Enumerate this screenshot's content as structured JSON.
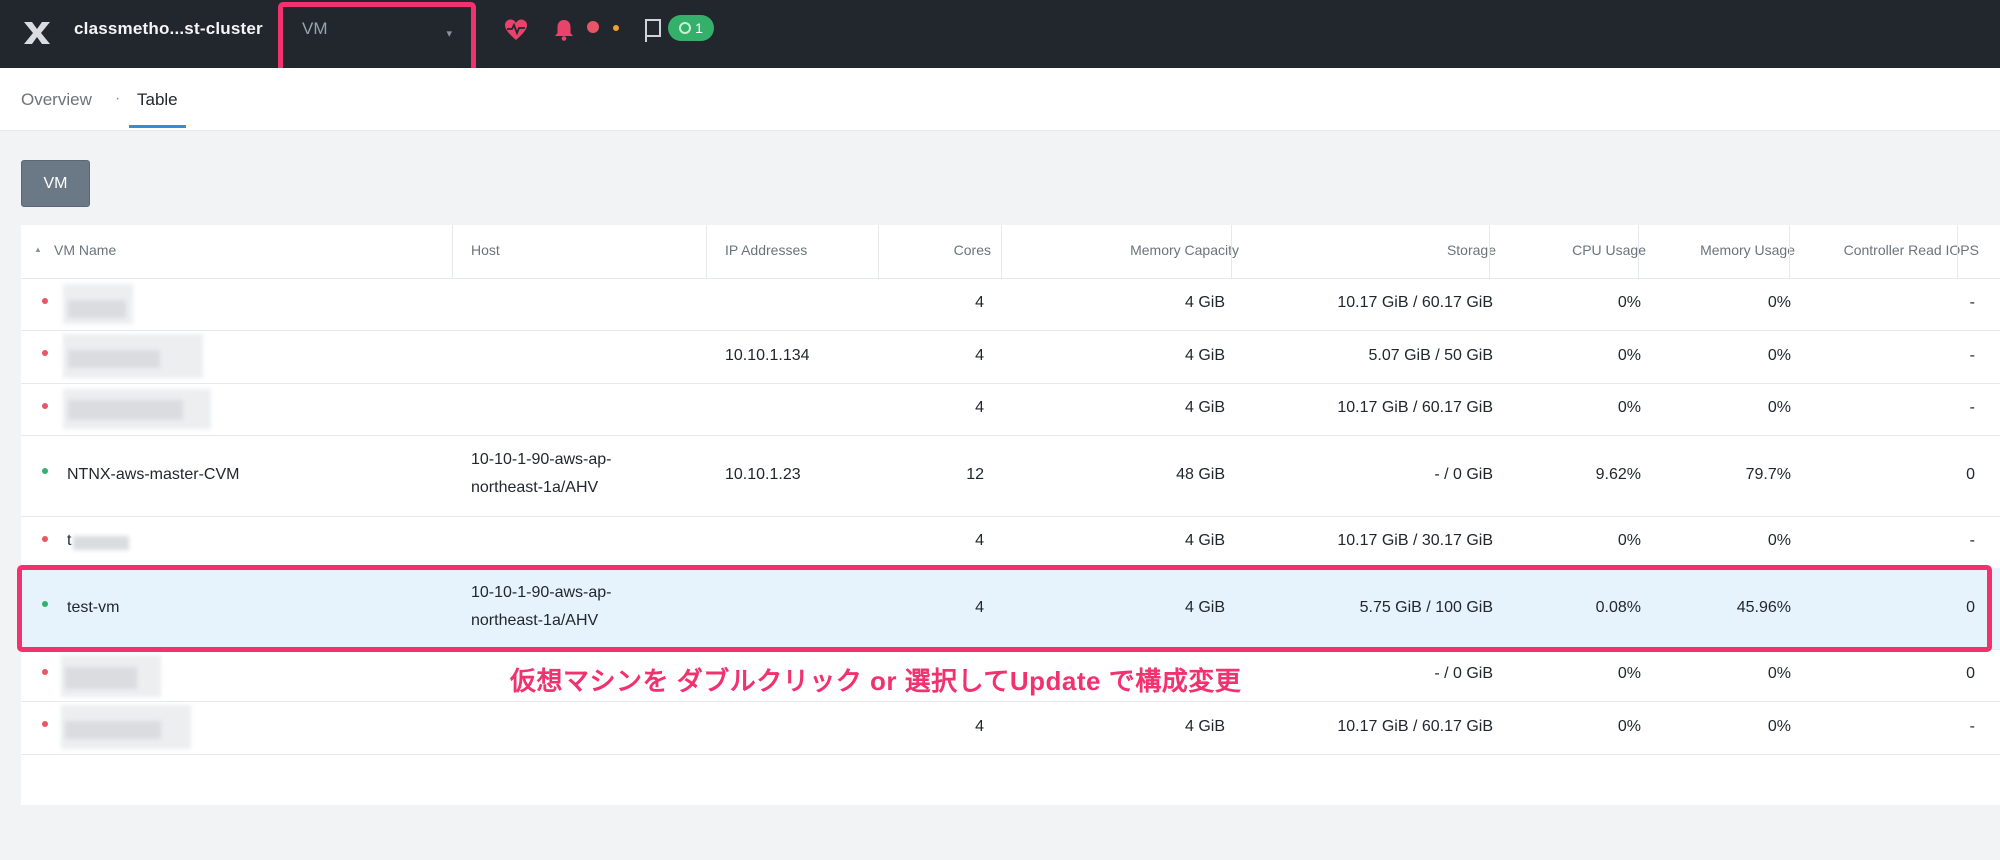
{
  "header": {
    "cluster_name": "classmetho...st-cluster",
    "entity_selector": "VM",
    "task_count": "1",
    "icons": [
      "x-logo-icon",
      "health-heart-icon",
      "alert-bell-icon",
      "task-flag-icon"
    ]
  },
  "tabs": {
    "overview": "Overview",
    "separator": "·",
    "table": "Table"
  },
  "vm_button": "VM",
  "table": {
    "columns": [
      "VM Name",
      "Host",
      "IP Addresses",
      "Cores",
      "Memory Capacity",
      "Storage",
      "CPU Usage",
      "Memory Usage",
      "Controller Read IOPS"
    ],
    "rows": [
      {
        "status": "off",
        "name": "",
        "host": "",
        "host2": "",
        "ip": "",
        "cores": "4",
        "memory": "4 GiB",
        "storage": "10.17 GiB / 60.17 GiB",
        "cpu": "0%",
        "mem_usage": "0%",
        "iops": "-"
      },
      {
        "status": "off",
        "name": "",
        "host": "",
        "host2": "",
        "ip": "10.10.1.134",
        "cores": "4",
        "memory": "4 GiB",
        "storage": "5.07 GiB / 50 GiB",
        "cpu": "0%",
        "mem_usage": "0%",
        "iops": "-"
      },
      {
        "status": "off",
        "name": "",
        "host": "",
        "host2": "",
        "ip": "",
        "cores": "4",
        "memory": "4 GiB",
        "storage": "10.17 GiB / 60.17 GiB",
        "cpu": "0%",
        "mem_usage": "0%",
        "iops": "-"
      },
      {
        "status": "on",
        "name": "NTNX-aws-master-CVM",
        "host": "10-10-1-90-aws-ap-",
        "host2": "northeast-1a/AHV",
        "ip": "10.10.1.23",
        "cores": "12",
        "memory": "48 GiB",
        "storage": "- / 0 GiB",
        "cpu": "9.62%",
        "mem_usage": "79.7%",
        "iops": "0"
      },
      {
        "status": "off",
        "name": "t",
        "host": "",
        "host2": "",
        "ip": "",
        "cores": "4",
        "memory": "4 GiB",
        "storage": "10.17 GiB / 30.17 GiB",
        "cpu": "0%",
        "mem_usage": "0%",
        "iops": "-"
      },
      {
        "status": "on",
        "name": "test-vm",
        "host": "10-10-1-90-aws-ap-",
        "host2": "northeast-1a/AHV",
        "ip": "",
        "cores": "4",
        "memory": "4 GiB",
        "storage": "5.75 GiB / 100 GiB",
        "cpu": "0.08%",
        "mem_usage": "45.96%",
        "iops": "0"
      },
      {
        "status": "off",
        "name": "",
        "host": "",
        "host2": "",
        "ip": "",
        "cores": "",
        "memory": "",
        "storage": "- / 0 GiB",
        "cpu": "0%",
        "mem_usage": "0%",
        "iops": "0"
      },
      {
        "status": "off",
        "name": "",
        "host": "",
        "host2": "",
        "ip": "",
        "cores": "4",
        "memory": "4 GiB",
        "storage": "10.17 GiB / 60.17 GiB",
        "cpu": "0%",
        "mem_usage": "0%",
        "iops": "-"
      }
    ]
  },
  "annotation": "仮想マシンを ダブルクリック or 選択してUpdate で構成変更",
  "colors": {
    "highlight": "#f2316f",
    "topbar": "#22272e",
    "selected_row": "#e6f2fc",
    "status_on": "#35b06a",
    "status_off": "#e85565"
  }
}
